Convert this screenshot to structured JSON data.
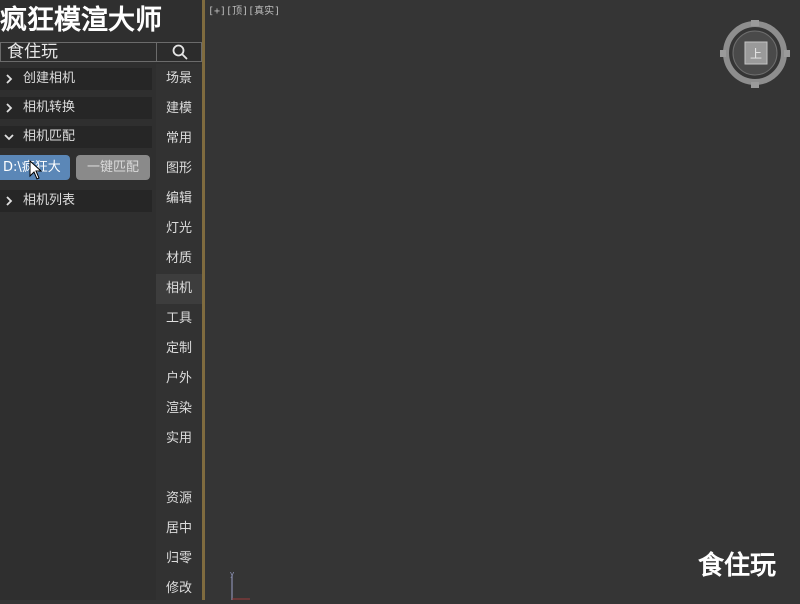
{
  "app": {
    "title": "疯狂模渲大师"
  },
  "search": {
    "value": "食住玩"
  },
  "sections": [
    {
      "label": "创建相机",
      "expanded": false
    },
    {
      "label": "相机转换",
      "expanded": false
    },
    {
      "label": "相机匹配",
      "expanded": true
    },
    {
      "label": "相机列表",
      "expanded": false
    }
  ],
  "match_panel": {
    "path_value": "D:\\疯狂大",
    "match_button": "一键匹配"
  },
  "tabs": [
    "场景",
    "建模",
    "常用",
    "图形",
    "编辑",
    "灯光",
    "材质",
    "相机",
    "工具",
    "定制",
    "户外",
    "渲染",
    "实用",
    "资源",
    "居中",
    "归零",
    "修改"
  ],
  "active_tab": "相机",
  "viewport": {
    "label": "[+][顶][真实]"
  },
  "viewcube": {
    "face": "上"
  },
  "watermark": "食住玩",
  "colors": {
    "accent": "#5b87b7",
    "divider": "#7f6b3f",
    "background": "#353535"
  }
}
